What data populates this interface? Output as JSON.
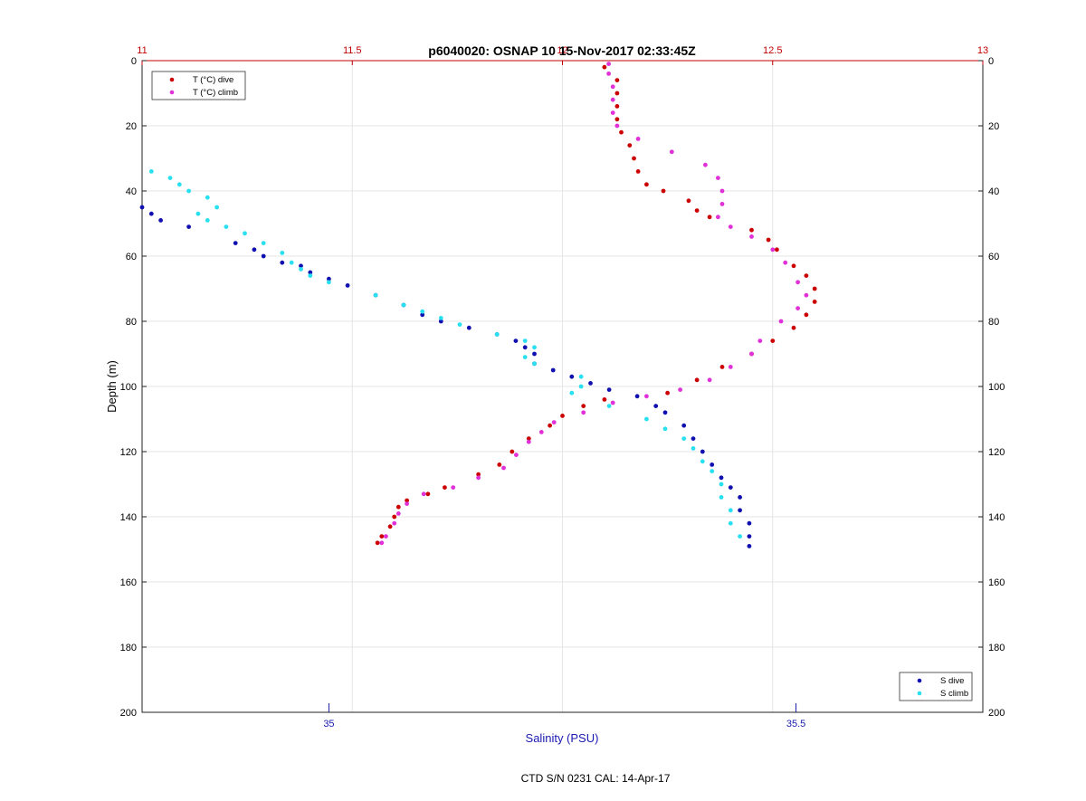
{
  "chart_data": {
    "type": "scatter",
    "title": "p6040020: OSNAP 10 15-Nov-2017 02:33:45Z",
    "ylabel": "Depth (m)",
    "xlabel": "Salinity (PSU)",
    "footnote": "CTD S/N 0231  CAL: 14-Apr-17",
    "ylim": [
      0,
      200
    ],
    "y_reversed": true,
    "y_ticks": [
      0,
      20,
      40,
      60,
      80,
      100,
      120,
      140,
      160,
      180,
      200
    ],
    "x_top": {
      "xlim": [
        11,
        13
      ],
      "ticks": [
        11,
        11.5,
        12,
        12.5,
        13
      ],
      "tick_labels": [
        "11",
        "11.5",
        "12",
        "12.5",
        "13"
      ],
      "color": "#c00000"
    },
    "x_bottom": {
      "xlim": [
        34.8,
        35.7
      ],
      "ticks": [
        35,
        35.5
      ],
      "tick_labels": [
        "35",
        "35.5"
      ],
      "color": "#1a1ab0"
    },
    "grid": true,
    "legend_top": {
      "placement": "top-left",
      "entries": [
        "T (°C) dive",
        "T (°C) climb"
      ]
    },
    "legend_bottom": {
      "placement": "bottom-right",
      "entries": [
        "S dive",
        "S climb"
      ]
    },
    "series": [
      {
        "name": "T (°C) dive",
        "axis": "top",
        "color": "#cc0000",
        "points": [
          [
            12.1,
            2
          ],
          [
            12.13,
            6
          ],
          [
            12.13,
            10
          ],
          [
            12.13,
            14
          ],
          [
            12.13,
            18
          ],
          [
            12.14,
            22
          ],
          [
            12.16,
            26
          ],
          [
            12.17,
            30
          ],
          [
            12.18,
            34
          ],
          [
            12.2,
            38
          ],
          [
            12.24,
            40
          ],
          [
            12.3,
            43
          ],
          [
            12.32,
            46
          ],
          [
            12.35,
            48
          ],
          [
            12.45,
            52
          ],
          [
            12.49,
            55
          ],
          [
            12.51,
            58
          ],
          [
            12.55,
            63
          ],
          [
            12.58,
            66
          ],
          [
            12.6,
            70
          ],
          [
            12.6,
            74
          ],
          [
            12.58,
            78
          ],
          [
            12.55,
            82
          ],
          [
            12.5,
            86
          ],
          [
            12.45,
            90
          ],
          [
            12.38,
            94
          ],
          [
            12.32,
            98
          ],
          [
            12.25,
            102
          ],
          [
            12.1,
            104
          ],
          [
            12.05,
            106
          ],
          [
            12.0,
            109
          ],
          [
            11.97,
            112
          ],
          [
            11.92,
            116
          ],
          [
            11.88,
            120
          ],
          [
            11.85,
            124
          ],
          [
            11.8,
            127
          ],
          [
            11.72,
            131
          ],
          [
            11.68,
            133
          ],
          [
            11.63,
            135
          ],
          [
            11.61,
            137
          ],
          [
            11.6,
            140
          ],
          [
            11.59,
            143
          ],
          [
            11.57,
            146
          ],
          [
            11.56,
            148
          ]
        ]
      },
      {
        "name": "T (°C) climb",
        "axis": "top",
        "color": "#e030d8",
        "points": [
          [
            12.11,
            1
          ],
          [
            12.11,
            4
          ],
          [
            12.12,
            8
          ],
          [
            12.12,
            12
          ],
          [
            12.12,
            16
          ],
          [
            12.13,
            20
          ],
          [
            12.18,
            24
          ],
          [
            12.26,
            28
          ],
          [
            12.34,
            32
          ],
          [
            12.37,
            36
          ],
          [
            12.38,
            40
          ],
          [
            12.38,
            44
          ],
          [
            12.37,
            48
          ],
          [
            12.4,
            51
          ],
          [
            12.45,
            54
          ],
          [
            12.5,
            58
          ],
          [
            12.53,
            62
          ],
          [
            12.56,
            68
          ],
          [
            12.58,
            72
          ],
          [
            12.56,
            76
          ],
          [
            12.52,
            80
          ],
          [
            12.47,
            86
          ],
          [
            12.45,
            90
          ],
          [
            12.4,
            94
          ],
          [
            12.35,
            98
          ],
          [
            12.28,
            101
          ],
          [
            12.2,
            103
          ],
          [
            12.12,
            105
          ],
          [
            12.05,
            108
          ],
          [
            11.98,
            111
          ],
          [
            11.95,
            114
          ],
          [
            11.92,
            117
          ],
          [
            11.89,
            121
          ],
          [
            11.86,
            125
          ],
          [
            11.8,
            128
          ],
          [
            11.74,
            131
          ],
          [
            11.67,
            133
          ],
          [
            11.63,
            136
          ],
          [
            11.61,
            139
          ],
          [
            11.6,
            142
          ],
          [
            11.58,
            146
          ],
          [
            11.57,
            148
          ]
        ]
      },
      {
        "name": "S dive",
        "axis": "bottom",
        "color": "#1010b0",
        "points": [
          [
            34.8,
            45
          ],
          [
            34.81,
            47
          ],
          [
            34.82,
            49
          ],
          [
            34.85,
            51
          ],
          [
            34.9,
            56
          ],
          [
            34.92,
            58
          ],
          [
            34.93,
            60
          ],
          [
            34.95,
            62
          ],
          [
            34.97,
            63
          ],
          [
            34.98,
            65
          ],
          [
            35.0,
            67
          ],
          [
            35.02,
            69
          ],
          [
            35.05,
            72
          ],
          [
            35.08,
            75
          ],
          [
            35.1,
            78
          ],
          [
            35.12,
            80
          ],
          [
            35.15,
            82
          ],
          [
            35.18,
            84
          ],
          [
            35.2,
            86
          ],
          [
            35.21,
            88
          ],
          [
            35.22,
            90
          ],
          [
            35.22,
            93
          ],
          [
            35.24,
            95
          ],
          [
            35.26,
            97
          ],
          [
            35.28,
            99
          ],
          [
            35.3,
            101
          ],
          [
            35.33,
            103
          ],
          [
            35.35,
            106
          ],
          [
            35.36,
            108
          ],
          [
            35.38,
            112
          ],
          [
            35.39,
            116
          ],
          [
            35.4,
            120
          ],
          [
            35.41,
            124
          ],
          [
            35.42,
            128
          ],
          [
            35.43,
            131
          ],
          [
            35.44,
            134
          ],
          [
            35.44,
            138
          ],
          [
            35.45,
            142
          ],
          [
            35.45,
            146
          ],
          [
            35.45,
            149
          ]
        ]
      },
      {
        "name": "S climb",
        "axis": "bottom",
        "color": "#28e0f0",
        "points": [
          [
            34.81,
            34
          ],
          [
            34.83,
            36
          ],
          [
            34.84,
            38
          ],
          [
            34.85,
            40
          ],
          [
            34.87,
            42
          ],
          [
            34.88,
            45
          ],
          [
            34.86,
            47
          ],
          [
            34.87,
            49
          ],
          [
            34.89,
            51
          ],
          [
            34.91,
            53
          ],
          [
            34.93,
            56
          ],
          [
            34.95,
            59
          ],
          [
            34.96,
            62
          ],
          [
            34.97,
            64
          ],
          [
            34.98,
            66
          ],
          [
            35.0,
            68
          ],
          [
            35.05,
            72
          ],
          [
            35.08,
            75
          ],
          [
            35.1,
            77
          ],
          [
            35.12,
            79
          ],
          [
            35.14,
            81
          ],
          [
            35.18,
            84
          ],
          [
            35.21,
            86
          ],
          [
            35.22,
            88
          ],
          [
            35.21,
            91
          ],
          [
            35.22,
            93
          ],
          [
            35.27,
            97
          ],
          [
            35.27,
            100
          ],
          [
            35.26,
            102
          ],
          [
            35.3,
            106
          ],
          [
            35.34,
            110
          ],
          [
            35.36,
            113
          ],
          [
            35.38,
            116
          ],
          [
            35.39,
            119
          ],
          [
            35.4,
            123
          ],
          [
            35.41,
            126
          ],
          [
            35.42,
            130
          ],
          [
            35.42,
            134
          ],
          [
            35.43,
            138
          ],
          [
            35.43,
            142
          ],
          [
            35.44,
            146
          ]
        ]
      }
    ]
  }
}
